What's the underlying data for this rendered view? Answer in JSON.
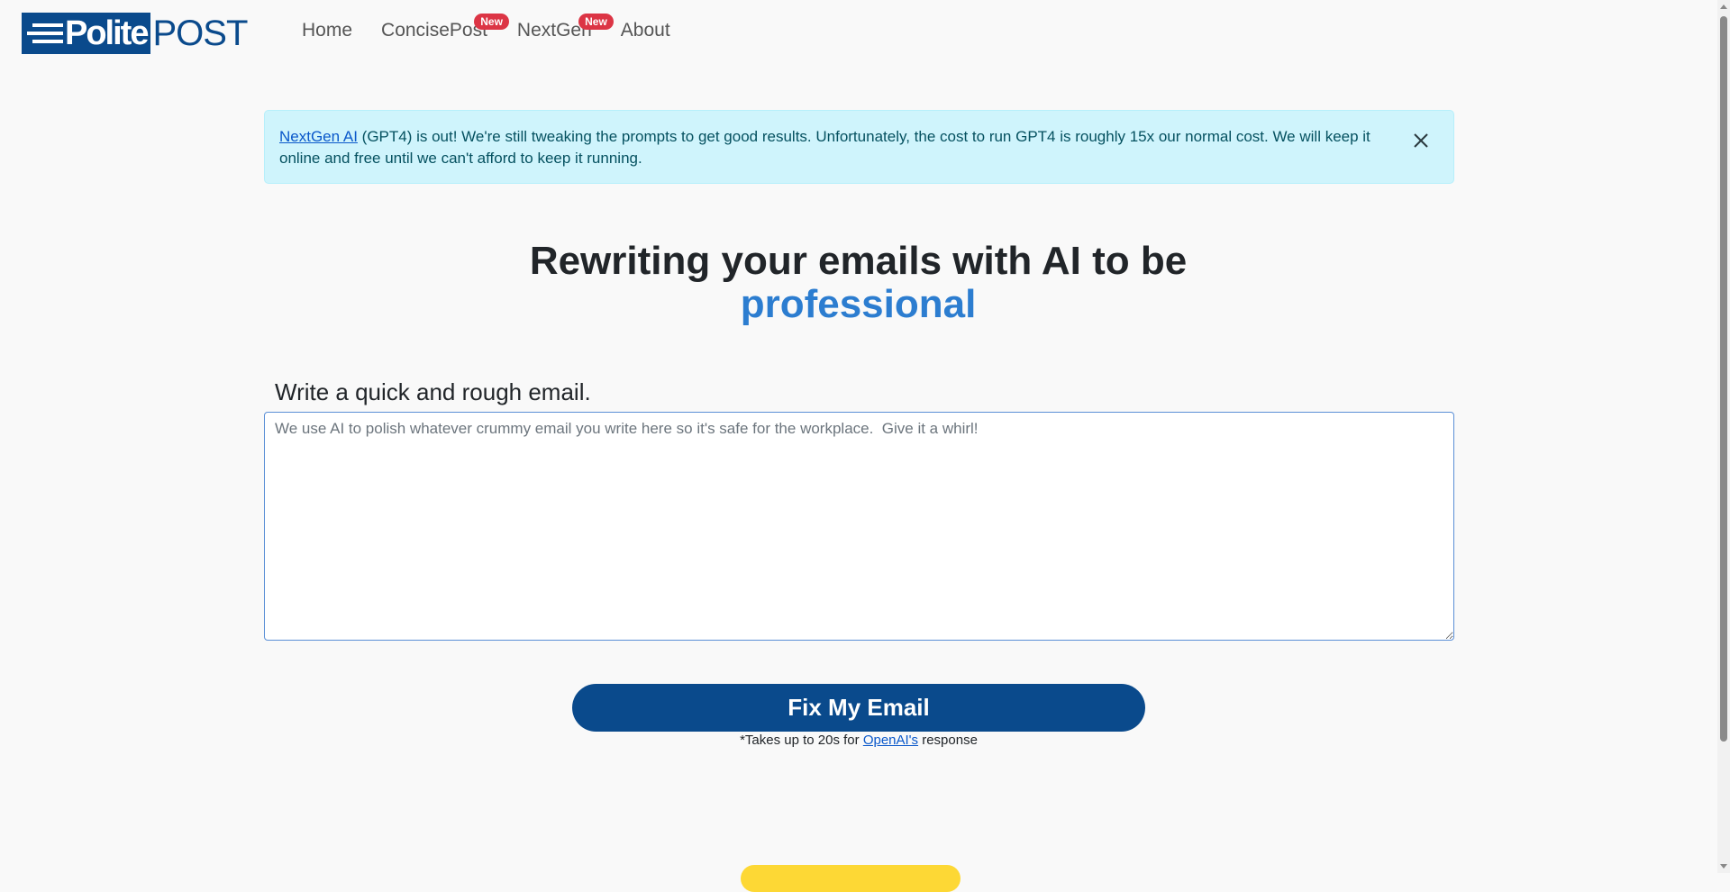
{
  "brand": {
    "logo_left": "Polite",
    "logo_right": "POST"
  },
  "nav": {
    "items": [
      {
        "label": "Home",
        "badge": null
      },
      {
        "label": "ConcisePost",
        "badge": "New"
      },
      {
        "label": "NextGen",
        "badge": "New"
      },
      {
        "label": "About",
        "badge": null
      }
    ]
  },
  "alert": {
    "link_text": "NextGen AI",
    "message": " (GPT4) is out! We're still tweaking the prompts to get good results. Unfortunately, the cost to run GPT4 is roughly 15x our normal cost. We will keep it online and free until we can't afford to keep it running.",
    "close_icon": "close-icon"
  },
  "hero": {
    "headline": "Rewriting your emails with AI to be",
    "accent_word": "professional",
    "accent_color": "#2c7dd0"
  },
  "form": {
    "label": "Write a quick and rough email.",
    "placeholder": "We use AI to polish whatever crummy email you write here so it's safe for the workplace.  Give it a whirl!",
    "value": "",
    "submit_label": "Fix My Email",
    "note_prefix": "*Takes up to 20s for ",
    "note_link": "OpenAI's",
    "note_suffix": " response"
  },
  "colors": {
    "brand_blue": "#0a4a8c",
    "alert_bg": "#cff4fc",
    "badge_red": "#dc3545",
    "yellow": "#fdd835"
  }
}
